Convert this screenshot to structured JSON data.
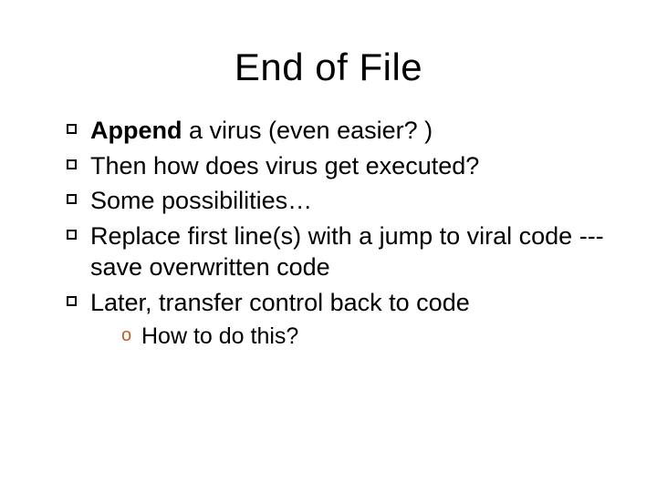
{
  "title": "End of File",
  "bullets": [
    {
      "lead": "Append",
      "rest": " a virus (even easier? )"
    },
    {
      "text": "Then how does virus get executed?"
    },
    {
      "text": "Some possibilities…"
    },
    {
      "text": "Replace first line(s) with a jump to viral code --- save overwritten code"
    },
    {
      "text": "Later, transfer control back to code"
    }
  ],
  "subbullets": [
    "How to do this?"
  ]
}
